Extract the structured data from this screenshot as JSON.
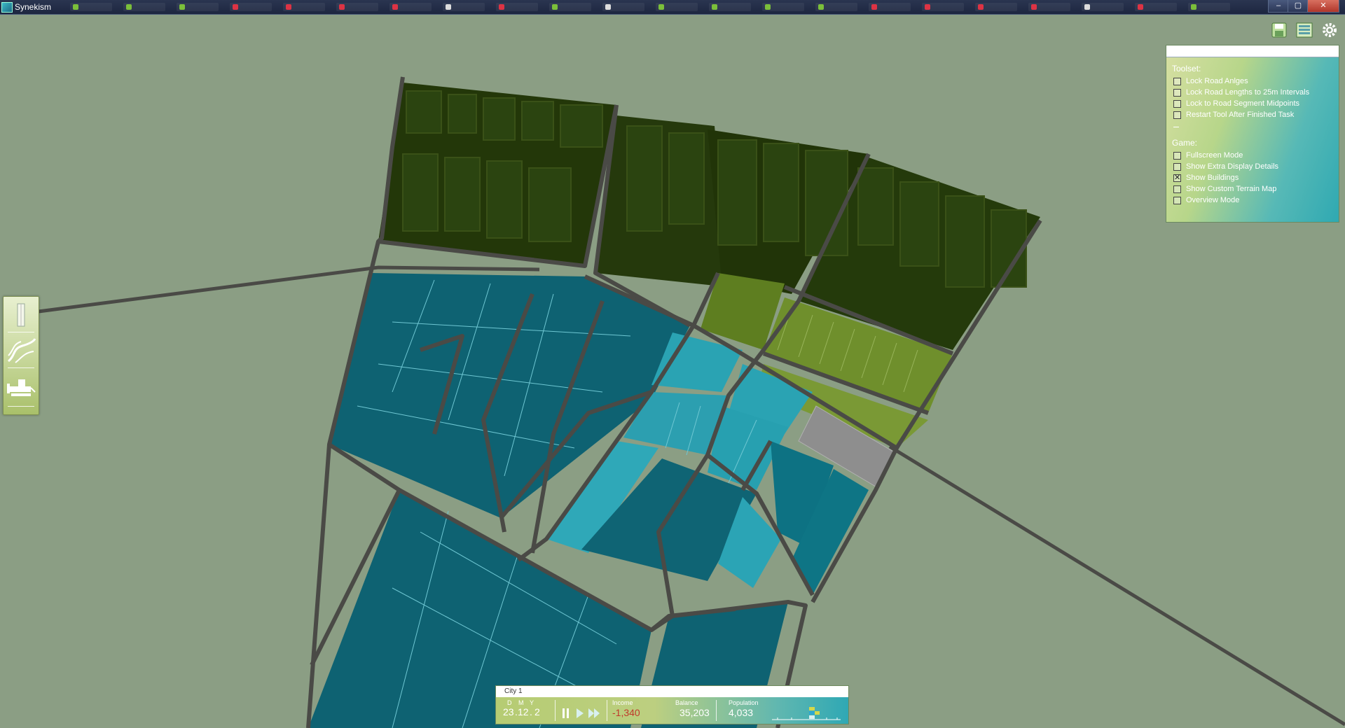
{
  "window": {
    "title": "Synekism",
    "controls": [
      "–",
      "▢",
      "✕"
    ]
  },
  "toolbar_left": {
    "tools": [
      {
        "name": "building-tool",
        "icon": "building-icon"
      },
      {
        "name": "road-tool",
        "icon": "road-icon"
      },
      {
        "name": "bulldozer-tool",
        "icon": "bulldozer-icon"
      }
    ]
  },
  "top_right_icons": [
    {
      "name": "save-icon"
    },
    {
      "name": "list-icon"
    },
    {
      "name": "gear-icon"
    }
  ],
  "options": {
    "toolset_label": "Toolset:",
    "toolset": [
      {
        "label": "Lock Road Anlges",
        "checked": false
      },
      {
        "label": "Lock Road Lengths to 25m Intervals",
        "checked": false
      },
      {
        "label": "Lock to Road Segment Midpoints",
        "checked": false
      },
      {
        "label": "Restart Tool After Finished Task",
        "checked": false
      }
    ],
    "game_label": "Game:",
    "game": [
      {
        "label": "Fullscreen Mode",
        "checked": false
      },
      {
        "label": "Show Extra Display Details",
        "checked": false
      },
      {
        "label": "Show Buildings",
        "checked": true
      },
      {
        "label": "Show Custom Terrain Map",
        "checked": false
      },
      {
        "label": "Overview Mode",
        "checked": false
      }
    ]
  },
  "status": {
    "city_name": "City 1",
    "date_labels": {
      "d": "D",
      "m": "M",
      "y": "Y"
    },
    "date": {
      "d": "23",
      "m": "12",
      "y": "2"
    },
    "income_label": "Income",
    "income": "-1,340",
    "balance_label": "Balance",
    "balance": "35,203",
    "population_label": "Population",
    "population": "4,033"
  },
  "colors": {
    "terrain": "#8b9e84",
    "road": "#4a4a46",
    "residential_dark": "#0e6272",
    "residential_light": "#2aa3b3",
    "forest": "#253a0d",
    "commercial": "#6f8f2c",
    "industrial": "#8e8e8e",
    "income_negative": "#c0392b"
  }
}
